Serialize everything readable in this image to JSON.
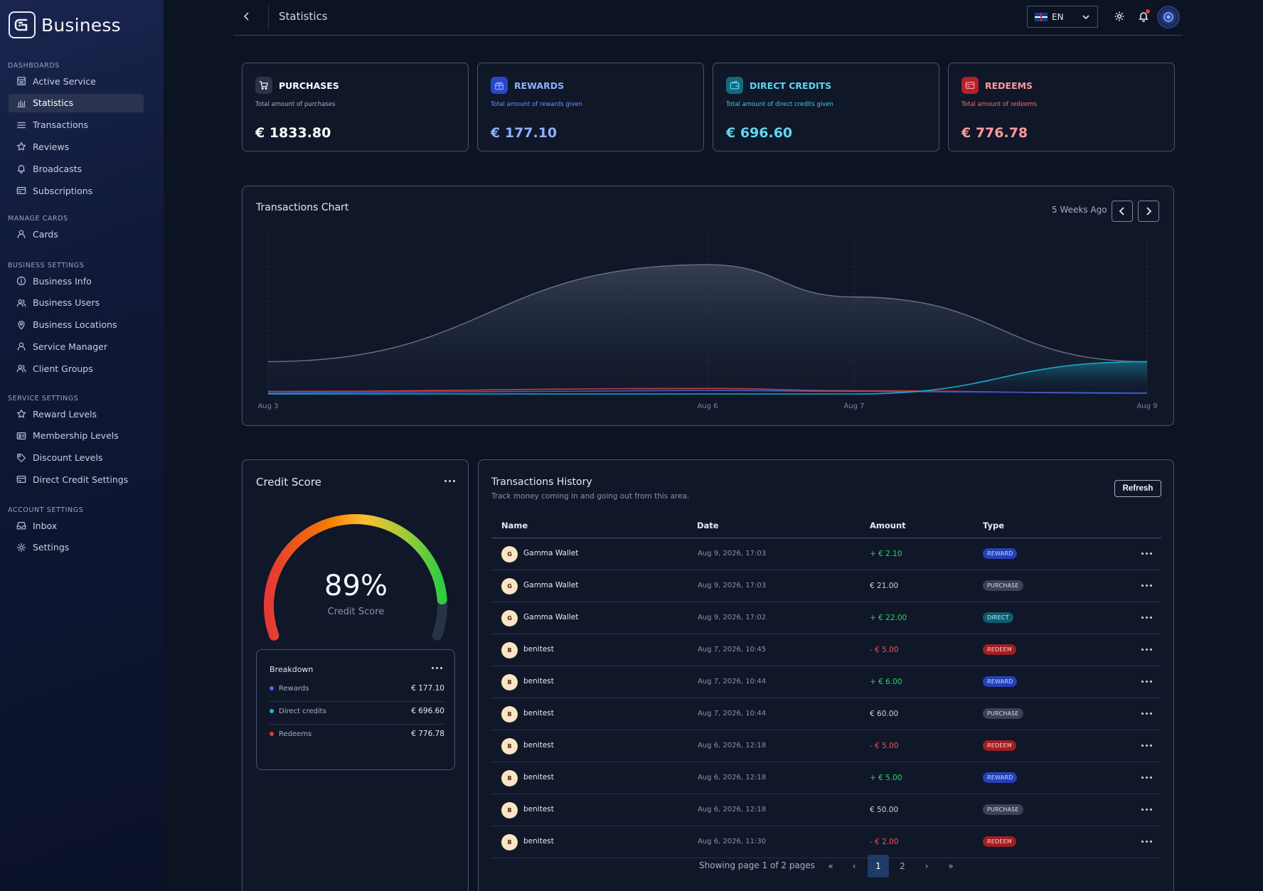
{
  "app": {
    "name": "Business",
    "logo_letter": "G"
  },
  "sidebar": {
    "sections": [
      {
        "title": "DASHBOARDS",
        "items": [
          {
            "label": "Active Service",
            "icon": "building-icon"
          },
          {
            "label": "Statistics",
            "icon": "bar-chart-icon",
            "active": true
          },
          {
            "label": "Transactions",
            "icon": "list-icon"
          },
          {
            "label": "Reviews",
            "icon": "star-icon"
          },
          {
            "label": "Broadcasts",
            "icon": "bell-icon"
          },
          {
            "label": "Subscriptions",
            "icon": "card-icon"
          }
        ]
      },
      {
        "title": "MANAGE CARDS",
        "items": [
          {
            "label": "Cards",
            "icon": "user-icon"
          }
        ]
      },
      {
        "title": "BUSINESS SETTINGS",
        "items": [
          {
            "label": "Business Info",
            "icon": "info-icon"
          },
          {
            "label": "Business Users",
            "icon": "users-icon"
          },
          {
            "label": "Business Locations",
            "icon": "pin-icon"
          },
          {
            "label": "Service Manager",
            "icon": "user-icon"
          },
          {
            "label": "Client Groups",
            "icon": "users-icon"
          }
        ]
      },
      {
        "title": "SERVICE SETTINGS",
        "items": [
          {
            "label": "Reward Levels",
            "icon": "star-icon"
          },
          {
            "label": "Membership Levels",
            "icon": "id-card-icon"
          },
          {
            "label": "Discount Levels",
            "icon": "tag-icon"
          },
          {
            "label": "Direct Credit Settings",
            "icon": "card-icon"
          }
        ]
      },
      {
        "title": "ACCOUNT SETTINGS",
        "items": [
          {
            "label": "Inbox",
            "icon": "inbox-icon"
          },
          {
            "label": "Settings",
            "icon": "gear-icon"
          }
        ]
      }
    ]
  },
  "header": {
    "title": "Statistics",
    "language": "EN"
  },
  "stats": [
    {
      "title": "PURCHASES",
      "subtitle": "Total amount of purchases",
      "value": "€ 1833.80",
      "color": "#ffffff",
      "sub_color": "#a7afc2",
      "badge_bg": "#2b3448",
      "icon": "cart-icon"
    },
    {
      "title": "REWARDS",
      "subtitle": "Total amount of rewards given",
      "value": "€ 177.10",
      "color": "#8fb0ff",
      "sub_color": "#6f93ff",
      "badge_bg": "#2747c9",
      "icon": "gift-icon"
    },
    {
      "title": "DIRECT CREDITS",
      "subtitle": "Total amount of direct credits given",
      "value": "€ 696.60",
      "color": "#5fd7f0",
      "sub_color": "#4cc5de",
      "badge_bg": "#136a7c",
      "icon": "wallet-icon"
    },
    {
      "title": "REDEEMS",
      "subtitle": "Total amount of redeems",
      "value": "€ 776.78",
      "color": "#ff9a9a",
      "sub_color": "#ff6b6b",
      "badge_bg": "#b3202a",
      "icon": "card-icon"
    }
  ],
  "chart": {
    "title": "Transactions Chart",
    "range_label": "5 Weeks Ago"
  },
  "chart_data": {
    "type": "area",
    "x": [
      "Aug 3",
      "Aug 6",
      "Aug 7",
      "Aug 9"
    ],
    "x_days": [
      3,
      6,
      7,
      9
    ],
    "series": [
      {
        "values": [
          1,
          4,
          3,
          1
        ],
        "color": "#6b7385"
      },
      {
        "values": [
          0.08,
          0.17,
          0.1,
          0.02
        ],
        "color": "#d23b3b"
      },
      {
        "values": [
          0.03,
          0.11,
          0.08,
          0.03
        ],
        "color": "#3d5fd6"
      },
      {
        "values": [
          0,
          0,
          0,
          1
        ],
        "color": "#1aa7c8"
      }
    ],
    "grid": "vertical-dashed",
    "legend": "none"
  },
  "credit": {
    "title": "Credit Score",
    "value": 89,
    "value_label": "89%",
    "caption": "Credit Score"
  },
  "breakdown": {
    "title": "Breakdown",
    "rows": [
      {
        "label": "Rewards",
        "value": "€ 177.10",
        "color": "#3d6bff"
      },
      {
        "label": "Direct credits",
        "value": "€ 696.60",
        "color": "#1fb6d8"
      },
      {
        "label": "Redeems",
        "value": "€ 776.78",
        "color": "#e53935"
      }
    ]
  },
  "transactions": {
    "title": "Transactions History",
    "subtitle": "Track money coming in and going out from this area.",
    "refresh_label": "Refresh",
    "columns": [
      "Name",
      "Date",
      "Amount",
      "Type"
    ],
    "rows": [
      {
        "initial": "G",
        "name": "Gamma Wallet",
        "date": "Aug 9, 2026, 17:03",
        "amount": "+ € 2.10",
        "type": "REWARD"
      },
      {
        "initial": "G",
        "name": "Gamma Wallet",
        "date": "Aug 9, 2026, 17:03",
        "amount": "€ 21.00",
        "type": "PURCHASE"
      },
      {
        "initial": "G",
        "name": "Gamma Wallet",
        "date": "Aug 9, 2026, 17:02",
        "amount": "+ € 22.00",
        "type": "DIRECT"
      },
      {
        "initial": "B",
        "name": "benitest",
        "date": "Aug 7, 2026, 10:45",
        "amount": "- € 5.00",
        "type": "REDEEM"
      },
      {
        "initial": "B",
        "name": "benitest",
        "date": "Aug 7, 2026, 10:44",
        "amount": "+ € 6.00",
        "type": "REWARD"
      },
      {
        "initial": "B",
        "name": "benitest",
        "date": "Aug 7, 2026, 10:44",
        "amount": "€ 60.00",
        "type": "PURCHASE"
      },
      {
        "initial": "B",
        "name": "benitest",
        "date": "Aug 6, 2026, 12:18",
        "amount": "- € 5.00",
        "type": "REDEEM"
      },
      {
        "initial": "B",
        "name": "benitest",
        "date": "Aug 6, 2026, 12:18",
        "amount": "+ € 5.00",
        "type": "REWARD"
      },
      {
        "initial": "B",
        "name": "benitest",
        "date": "Aug 6, 2026, 12:18",
        "amount": "€ 50.00",
        "type": "PURCHASE"
      },
      {
        "initial": "B",
        "name": "benitest",
        "date": "Aug 6, 2026, 11:30",
        "amount": "- € 2.00",
        "type": "REDEEM"
      }
    ],
    "type_styles": {
      "REWARD": {
        "bg": "#2342b8",
        "fg": "#cfd9ff"
      },
      "PURCHASE": {
        "bg": "#3a4255",
        "fg": "#d6dae4"
      },
      "DIRECT": {
        "bg": "#0f5c6e",
        "fg": "#b8effa"
      },
      "REDEEM": {
        "bg": "#a11d24",
        "fg": "#ffd2d2"
      }
    },
    "amount_colors": {
      "positive": "#2fd36a",
      "negative": "#ff4d4d",
      "neutral": "#c9cfde"
    },
    "pagination": {
      "text": "Showing page 1 of 2 pages",
      "pages": [
        "1",
        "2"
      ],
      "current": "1",
      "first": "«",
      "prev": "‹",
      "next": "›",
      "last": "»"
    }
  }
}
